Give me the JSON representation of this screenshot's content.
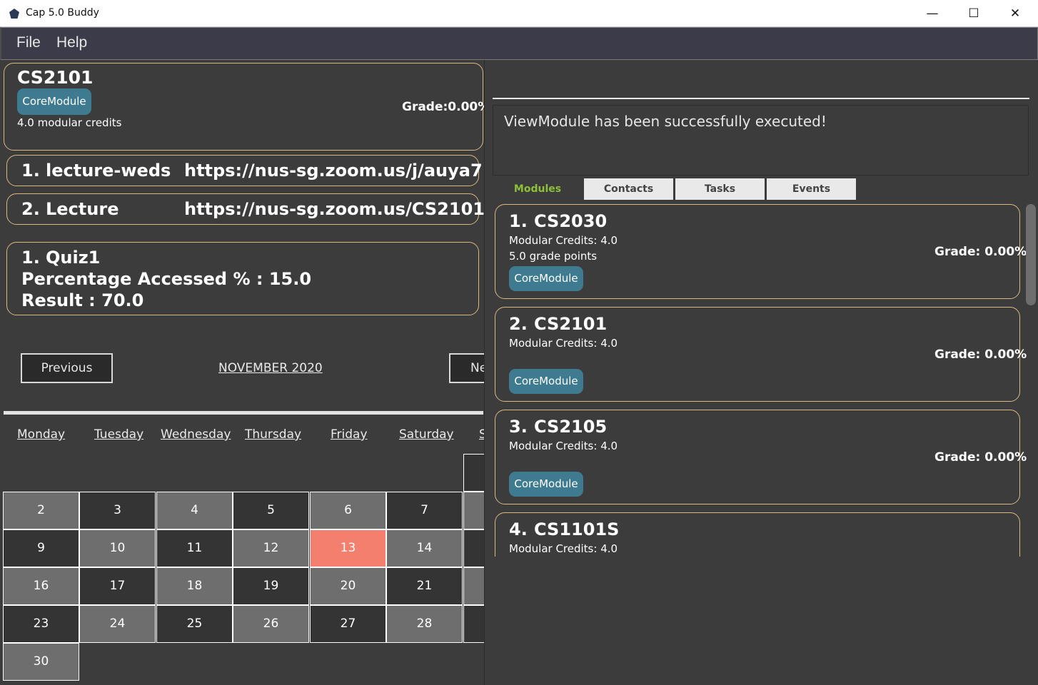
{
  "window": {
    "title": "Cap 5.0 Buddy",
    "minimize": "—",
    "maximize": "☐",
    "close": "✕"
  },
  "menu": {
    "file": "File",
    "help": "Help"
  },
  "module_detail": {
    "code": "CS2101",
    "tag": "CoreModule",
    "credits": "4.0 modular credits",
    "grade": "Grade:0.00%"
  },
  "zoom_links": [
    {
      "index": "1.",
      "name": "lecture-weds",
      "url": "https://nus-sg.zoom.us/j/auya7..."
    },
    {
      "index": "2.",
      "name": "Lecture",
      "url": "https://nus-sg.zoom.us/CS2101"
    }
  ],
  "assessment": {
    "index": "1.",
    "name": "Quiz1",
    "percentage": "Percentage Accessed % : 15.0",
    "result": "Result : 70.0"
  },
  "calendar": {
    "previous": "Previous",
    "next": "Ne",
    "month": "NOVEMBER 2020",
    "days": [
      "Monday",
      "Tuesday",
      "Wednesday",
      "Thursday",
      "Friday",
      "Saturday",
      "S"
    ],
    "weeks": [
      [
        "2",
        "3",
        "4",
        "5",
        "6",
        "7"
      ],
      [
        "9",
        "10",
        "11",
        "12",
        "13",
        "14"
      ],
      [
        "16",
        "17",
        "18",
        "19",
        "20",
        "21"
      ],
      [
        "23",
        "24",
        "25",
        "26",
        "27",
        "28"
      ],
      [
        "30"
      ]
    ]
  },
  "result_message": "ViewModule has been successfully executed!",
  "tabs": [
    "Modules",
    "Contacts",
    "Tasks",
    "Events"
  ],
  "modules": [
    {
      "index": "1.",
      "code": "CS2030",
      "credits": "Modular Credits: 4.0",
      "points": "5.0 grade points",
      "tag": "CoreModule",
      "grade": "Grade: 0.00%"
    },
    {
      "index": "2.",
      "code": "CS2101",
      "credits": "Modular Credits: 4.0",
      "points": "",
      "tag": "CoreModule",
      "grade": "Grade: 0.00%"
    },
    {
      "index": "3.",
      "code": "CS2105",
      "credits": "Modular Credits: 4.0",
      "points": "",
      "tag": "CoreModule",
      "grade": "Grade: 0.00%"
    },
    {
      "index": "4.",
      "code": "CS1101S",
      "credits": "Modular Credits: 4.0",
      "points": "",
      "tag": "",
      "grade": ""
    }
  ]
}
